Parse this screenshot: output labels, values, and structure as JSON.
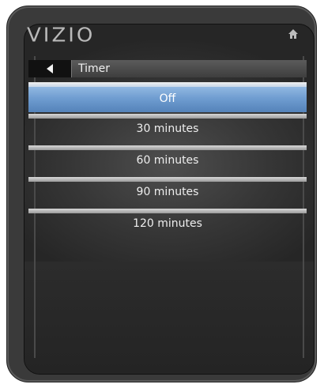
{
  "brand": {
    "logo_text": "VIZIO"
  },
  "icons": {
    "home": "home-icon",
    "back": "back-arrow-icon"
  },
  "nav": {
    "title": "Timer"
  },
  "menu": {
    "items": [
      {
        "label": "Off",
        "selected": true
      },
      {
        "label": "30 minutes",
        "selected": false
      },
      {
        "label": "60 minutes",
        "selected": false
      },
      {
        "label": "90 minutes",
        "selected": false
      },
      {
        "label": "120 minutes",
        "selected": false
      }
    ]
  },
  "colors": {
    "selected_highlight": "#6e9cd0",
    "background": "#363636"
  }
}
